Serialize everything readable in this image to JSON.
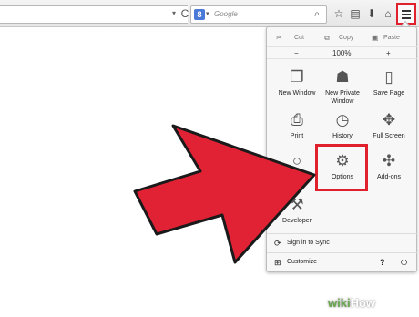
{
  "toolbar": {
    "search_engine_letter": "8",
    "search_placeholder": "Google",
    "url_dropdown_glyph": "▾",
    "reload_glyph": "C",
    "search_arrow_glyph": "▾",
    "search_glyph": "⌕",
    "bookmark_star_glyph": "☆",
    "bookmarks_list_glyph": "▤",
    "downloads_glyph": "⬇",
    "home_glyph": "⌂"
  },
  "panel": {
    "edit": {
      "cut": "Cut",
      "copy": "Copy",
      "paste": "Paste"
    },
    "zoom": {
      "minus": "−",
      "level": "100%",
      "plus": "+"
    },
    "tiles": [
      {
        "id": "new-window",
        "label": "New Window",
        "icon": "window-icon",
        "glyph": "❐"
      },
      {
        "id": "new-private-window",
        "label": "New Private Window",
        "icon": "mask-icon",
        "glyph": "☗"
      },
      {
        "id": "save-page",
        "label": "Save Page",
        "icon": "page-icon",
        "glyph": "▯"
      },
      {
        "id": "print",
        "label": "Print",
        "icon": "printer-icon",
        "glyph": "⎙"
      },
      {
        "id": "history",
        "label": "History",
        "icon": "clock-icon",
        "glyph": "◷"
      },
      {
        "id": "full-screen",
        "label": "Full Screen",
        "icon": "expand-icon",
        "glyph": "✥"
      },
      {
        "id": "find",
        "label": "",
        "icon": "magnifier-icon",
        "glyph": "○"
      },
      {
        "id": "options",
        "label": "Options",
        "icon": "gear-icon",
        "glyph": "⚙"
      },
      {
        "id": "add-ons",
        "label": "Add-ons",
        "icon": "puzzle-icon",
        "glyph": "✣"
      },
      {
        "id": "developer",
        "label": "Developer",
        "icon": "wrench-icon",
        "glyph": "⚒"
      }
    ],
    "sync": {
      "label": "Sign in to Sync",
      "glyph": "⟳"
    },
    "footer": {
      "customize": "Customize",
      "plus_glyph": "⊞",
      "help_glyph": "?",
      "power_glyph": "⏻"
    }
  },
  "watermark": {
    "part1": "wiki",
    "part2": "How"
  },
  "colors": {
    "highlight": "#e0202c",
    "arrow": "#e02234",
    "watermark_green": "#6aa84f"
  }
}
